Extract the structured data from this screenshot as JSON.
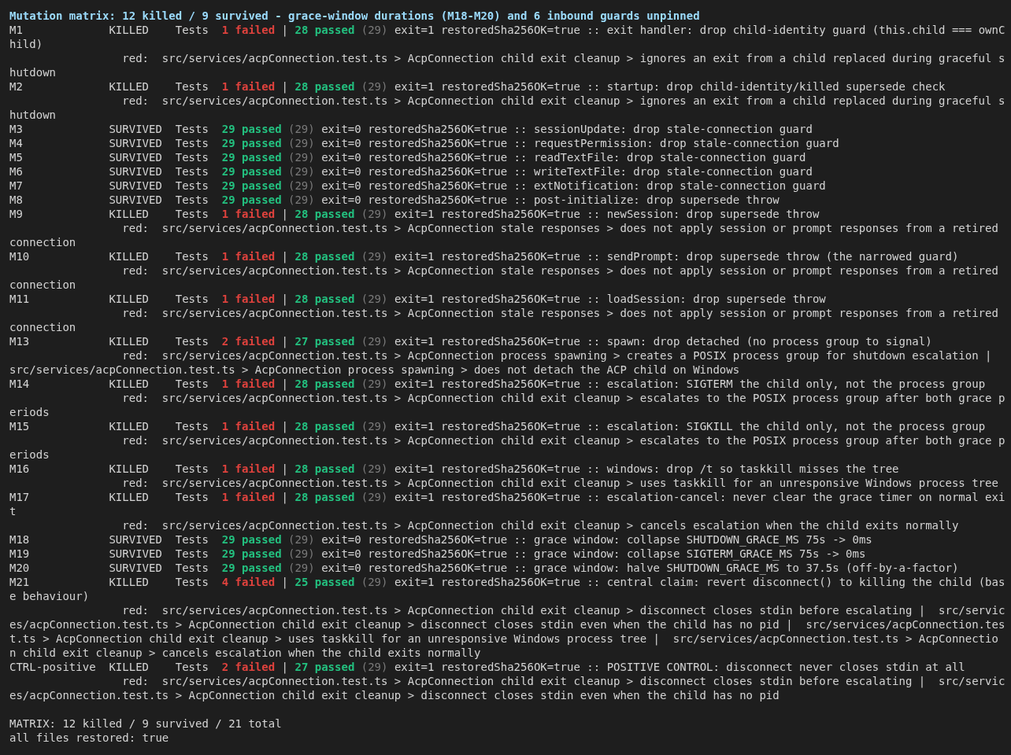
{
  "header": "Mutation matrix: 12 killed / 9 survived - grace-window durations (M18-M20) and 6 inbound guards unpinned",
  "rows": [
    {
      "id": "M1",
      "status": "KILLED",
      "tests": "Tests",
      "failed": "1 failed",
      "divider": "|",
      "passed": "28 passed",
      "total": "(29)",
      "detail": "exit=1 restoredSha256OK=true :: exit handler: drop child-identity guard (this.child === ownChild)",
      "red_label": "red:",
      "red": "src/services/acpConnection.test.ts > AcpConnection child exit cleanup > ignores an exit from a child replaced during graceful shutdown"
    },
    {
      "id": "M2",
      "status": "KILLED",
      "tests": "Tests",
      "failed": "1 failed",
      "divider": "|",
      "passed": "28 passed",
      "total": "(29)",
      "detail": "exit=1 restoredSha256OK=true :: startup: drop child-identity/killed supersede check",
      "red_label": "red:",
      "red": "src/services/acpConnection.test.ts > AcpConnection child exit cleanup > ignores an exit from a child replaced during graceful shutdown"
    },
    {
      "id": "M3",
      "status": "SURVIVED",
      "tests": "Tests",
      "passed": "29 passed",
      "total": "(29)",
      "detail": "exit=0 restoredSha256OK=true :: sessionUpdate: drop stale-connection guard"
    },
    {
      "id": "M4",
      "status": "SURVIVED",
      "tests": "Tests",
      "passed": "29 passed",
      "total": "(29)",
      "detail": "exit=0 restoredSha256OK=true :: requestPermission: drop stale-connection guard"
    },
    {
      "id": "M5",
      "status": "SURVIVED",
      "tests": "Tests",
      "passed": "29 passed",
      "total": "(29)",
      "detail": "exit=0 restoredSha256OK=true :: readTextFile: drop stale-connection guard"
    },
    {
      "id": "M6",
      "status": "SURVIVED",
      "tests": "Tests",
      "passed": "29 passed",
      "total": "(29)",
      "detail": "exit=0 restoredSha256OK=true :: writeTextFile: drop stale-connection guard"
    },
    {
      "id": "M7",
      "status": "SURVIVED",
      "tests": "Tests",
      "passed": "29 passed",
      "total": "(29)",
      "detail": "exit=0 restoredSha256OK=true :: extNotification: drop stale-connection guard"
    },
    {
      "id": "M8",
      "status": "SURVIVED",
      "tests": "Tests",
      "passed": "29 passed",
      "total": "(29)",
      "detail": "exit=0 restoredSha256OK=true :: post-initialize: drop supersede throw"
    },
    {
      "id": "M9",
      "status": "KILLED",
      "tests": "Tests",
      "failed": "1 failed",
      "divider": "|",
      "passed": "28 passed",
      "total": "(29)",
      "detail": "exit=1 restoredSha256OK=true :: newSession: drop supersede throw",
      "red_label": "red:",
      "red": "src/services/acpConnection.test.ts > AcpConnection stale responses > does not apply session or prompt responses from a retired connection"
    },
    {
      "id": "M10",
      "status": "KILLED",
      "tests": "Tests",
      "failed": "1 failed",
      "divider": "|",
      "passed": "28 passed",
      "total": "(29)",
      "detail": "exit=1 restoredSha256OK=true :: sendPrompt: drop supersede throw (the narrowed guard)",
      "red_label": "red:",
      "red": "src/services/acpConnection.test.ts > AcpConnection stale responses > does not apply session or prompt responses from a retired connection"
    },
    {
      "id": "M11",
      "status": "KILLED",
      "tests": "Tests",
      "failed": "1 failed",
      "divider": "|",
      "passed": "28 passed",
      "total": "(29)",
      "detail": "exit=1 restoredSha256OK=true :: loadSession: drop supersede throw",
      "red_label": "red:",
      "red": "src/services/acpConnection.test.ts > AcpConnection stale responses > does not apply session or prompt responses from a retired connection"
    },
    {
      "id": "M13",
      "status": "KILLED",
      "tests": "Tests",
      "failed": "2 failed",
      "divider": "|",
      "passed": "27 passed",
      "total": "(29)",
      "detail": "exit=1 restoredSha256OK=true :: spawn: drop detached (no process group to signal)",
      "red_label": "red:",
      "red": "src/services/acpConnection.test.ts > AcpConnection process spawning > creates a POSIX process group for shutdown escalation |  src/services/acpConnection.test.ts > AcpConnection process spawning > does not detach the ACP child on Windows"
    },
    {
      "id": "M14",
      "status": "KILLED",
      "tests": "Tests",
      "failed": "1 failed",
      "divider": "|",
      "passed": "28 passed",
      "total": "(29)",
      "detail": "exit=1 restoredSha256OK=true :: escalation: SIGTERM the child only, not the process group",
      "red_label": "red:",
      "red": "src/services/acpConnection.test.ts > AcpConnection child exit cleanup > escalates to the POSIX process group after both grace periods"
    },
    {
      "id": "M15",
      "status": "KILLED",
      "tests": "Tests",
      "failed": "1 failed",
      "divider": "|",
      "passed": "28 passed",
      "total": "(29)",
      "detail": "exit=1 restoredSha256OK=true :: escalation: SIGKILL the child only, not the process group",
      "red_label": "red:",
      "red": "src/services/acpConnection.test.ts > AcpConnection child exit cleanup > escalates to the POSIX process group after both grace periods"
    },
    {
      "id": "M16",
      "status": "KILLED",
      "tests": "Tests",
      "failed": "1 failed",
      "divider": "|",
      "passed": "28 passed",
      "total": "(29)",
      "detail": "exit=1 restoredSha256OK=true :: windows: drop /t so taskkill misses the tree",
      "red_label": "red:",
      "red": "src/services/acpConnection.test.ts > AcpConnection child exit cleanup > uses taskkill for an unresponsive Windows process tree"
    },
    {
      "id": "M17",
      "status": "KILLED",
      "tests": "Tests",
      "failed": "1 failed",
      "divider": "|",
      "passed": "28 passed",
      "total": "(29)",
      "detail": "exit=1 restoredSha256OK=true :: escalation-cancel: never clear the grace timer on normal exit",
      "red_label": "red:",
      "red": "src/services/acpConnection.test.ts > AcpConnection child exit cleanup > cancels escalation when the child exits normally"
    },
    {
      "id": "M18",
      "status": "SURVIVED",
      "tests": "Tests",
      "passed": "29 passed",
      "total": "(29)",
      "detail": "exit=0 restoredSha256OK=true :: grace window: collapse SHUTDOWN_GRACE_MS 75s -> 0ms"
    },
    {
      "id": "M19",
      "status": "SURVIVED",
      "tests": "Tests",
      "passed": "29 passed",
      "total": "(29)",
      "detail": "exit=0 restoredSha256OK=true :: grace window: collapse SIGTERM_GRACE_MS 75s -> 0ms"
    },
    {
      "id": "M20",
      "status": "SURVIVED",
      "tests": "Tests",
      "passed": "29 passed",
      "total": "(29)",
      "detail": "exit=0 restoredSha256OK=true :: grace window: halve SHUTDOWN_GRACE_MS to 37.5s (off-by-a-factor)"
    },
    {
      "id": "M21",
      "status": "KILLED",
      "tests": "Tests",
      "failed": "4 failed",
      "divider": "|",
      "passed": "25 passed",
      "total": "(29)",
      "detail": "exit=1 restoredSha256OK=true :: central claim: revert disconnect() to killing the child (base behaviour)",
      "red_label": "red:",
      "red": "src/services/acpConnection.test.ts > AcpConnection child exit cleanup > disconnect closes stdin before escalating |  src/services/acpConnection.test.ts > AcpConnection child exit cleanup > disconnect closes stdin even when the child has no pid |  src/services/acpConnection.test.ts > AcpConnection child exit cleanup > uses taskkill for an unresponsive Windows process tree |  src/services/acpConnection.test.ts > AcpConnection child exit cleanup > cancels escalation when the child exits normally"
    },
    {
      "id": "CTRL-positive",
      "status": "KILLED",
      "tests": "Tests",
      "failed": "2 failed",
      "divider": "|",
      "passed": "27 passed",
      "total": "(29)",
      "detail": "exit=1 restoredSha256OK=true :: POSITIVE CONTROL: disconnect never closes stdin at all",
      "red_label": "red:",
      "red": "src/services/acpConnection.test.ts > AcpConnection child exit cleanup > disconnect closes stdin before escalating |  src/services/acpConnection.test.ts > AcpConnection child exit cleanup > disconnect closes stdin even when the child has no pid"
    }
  ],
  "footer": [
    "MATRIX: 12 killed / 9 survived / 21 total",
    "all files restored: true"
  ]
}
